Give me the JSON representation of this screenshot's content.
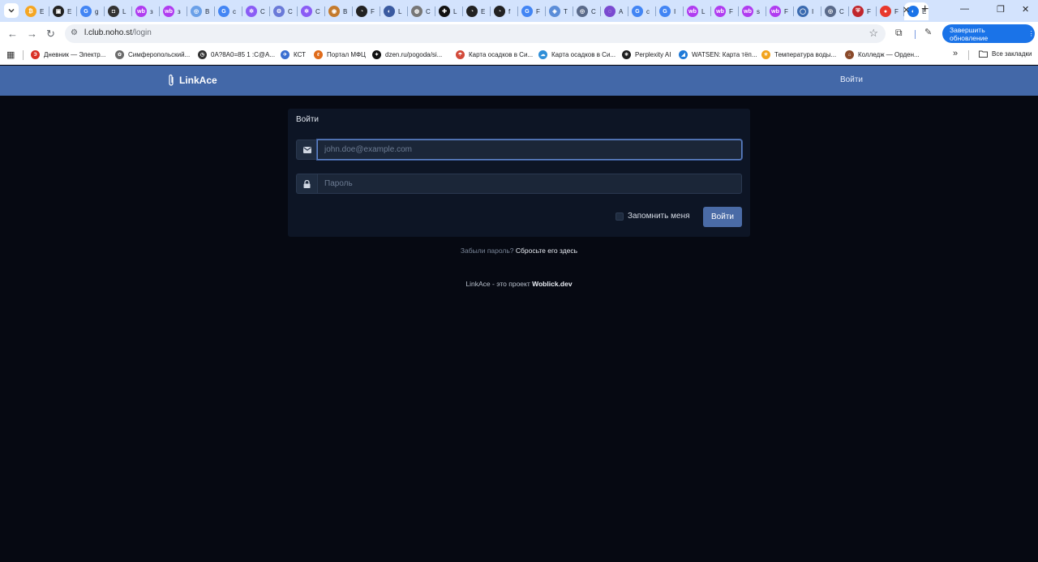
{
  "browser": {
    "tabs": [
      {
        "color": "#f5a623",
        "glyph": "₿",
        "text": "E"
      },
      {
        "color": "#222222",
        "glyph": "▣",
        "text": "E"
      },
      {
        "color": "#4285f4",
        "glyph": "G",
        "text": "g"
      },
      {
        "color": "#333333",
        "glyph": "◘",
        "text": "L"
      },
      {
        "color": "#b03cf0",
        "glyph": "wb",
        "text": "з"
      },
      {
        "color": "#b03cf0",
        "glyph": "wb",
        "text": "з"
      },
      {
        "color": "#6aa0e8",
        "glyph": "◎",
        "text": "B"
      },
      {
        "color": "#4285f4",
        "glyph": "G",
        "text": "c"
      },
      {
        "color": "#8a5cf5",
        "glyph": "✲",
        "text": "C"
      },
      {
        "color": "#6a7ad8",
        "glyph": "⚙",
        "text": "C"
      },
      {
        "color": "#8a5cf5",
        "glyph": "✲",
        "text": "C"
      },
      {
        "color": "#c47a2c",
        "glyph": "◉",
        "text": "B"
      },
      {
        "color": "#222222",
        "glyph": "◔",
        "text": "F"
      },
      {
        "color": "#3a5aa0",
        "glyph": "◐",
        "text": "L"
      },
      {
        "color": "#777777",
        "glyph": "◍",
        "text": "C"
      },
      {
        "color": "#111111",
        "glyph": "✚",
        "text": "L"
      },
      {
        "color": "#222222",
        "glyph": "◔",
        "text": "E"
      },
      {
        "color": "#222222",
        "glyph": "◔",
        "text": "f"
      },
      {
        "color": "#4285f4",
        "glyph": "G",
        "text": "F"
      },
      {
        "color": "#5b8dd8",
        "glyph": "◈",
        "text": "T"
      },
      {
        "color": "#5a6a8a",
        "glyph": "◎",
        "text": "C"
      },
      {
        "color": "#7a4ad0",
        "glyph": "◌",
        "text": "A"
      },
      {
        "color": "#4285f4",
        "glyph": "G",
        "text": "c"
      },
      {
        "color": "#4285f4",
        "glyph": "G",
        "text": "I"
      },
      {
        "color": "#b03cf0",
        "glyph": "wb",
        "text": "L"
      },
      {
        "color": "#b03cf0",
        "glyph": "wb",
        "text": "F"
      },
      {
        "color": "#b03cf0",
        "glyph": "wb",
        "text": "s"
      },
      {
        "color": "#b03cf0",
        "glyph": "wb",
        "text": "F"
      },
      {
        "color": "#3a6ab0",
        "glyph": "◯",
        "text": "I"
      },
      {
        "color": "#5a6a8a",
        "glyph": "◎",
        "text": "C"
      },
      {
        "color": "#c0262d",
        "glyph": "⛨",
        "text": "F"
      },
      {
        "color": "#e8382d",
        "glyph": "●",
        "text": "F"
      },
      {
        "color": "#1a73e8",
        "glyph": "◐",
        "text": "E",
        "active": true
      }
    ],
    "new_tab": "+",
    "url_host": "l.club.noho.st",
    "url_path": "/login",
    "update_button": "Завершить обновление",
    "bookmarks": [
      {
        "label": "Дневник — Электр...",
        "color": "#d93025",
        "glyph": "Э"
      },
      {
        "label": "Симферопольский...",
        "color": "#6b6b6b",
        "glyph": "✿"
      },
      {
        "label": "0A?8A0=85 1 :C@A...",
        "color": "#333333",
        "glyph": "◷"
      },
      {
        "label": "КСТ",
        "color": "#3b6fd1",
        "glyph": "✈"
      },
      {
        "label": "Портал МФЦ",
        "color": "#e06c1b",
        "glyph": "ℓ"
      },
      {
        "label": "dzen.ru/pogoda/si...",
        "color": "#111111",
        "glyph": "✦"
      },
      {
        "label": "Карта осадков в Си...",
        "color": "#d24a3a",
        "glyph": "☂"
      },
      {
        "label": "Карта осадков в Си...",
        "color": "#2f8fd8",
        "glyph": "☁"
      },
      {
        "label": "Perplexity AI",
        "color": "#1e1e1e",
        "glyph": "✳"
      },
      {
        "label": "WATSEN: Карта тёп...",
        "color": "#1f7ad8",
        "glyph": "◢"
      },
      {
        "label": "Температура воды...",
        "color": "#f2a31b",
        "glyph": "☀"
      },
      {
        "label": "Колледж — Орден...",
        "color": "#8a4a2a",
        "glyph": "⌂"
      }
    ],
    "bookmarks_more": "»",
    "all_bookmarks": "Все закладки"
  },
  "app": {
    "brand": "LinkAce",
    "nav_login": "Войти",
    "card_title": "Войти",
    "email_placeholder": "john.doe@example.com",
    "password_placeholder": "Пароль",
    "remember_label": "Запомнить меня",
    "submit_label": "Войти",
    "forgot_text": "Забыли пароль?",
    "forgot_link": "Сбросьте его здесь",
    "footer_text": "LinkAce - это проект",
    "footer_link": "Woblick.dev"
  }
}
